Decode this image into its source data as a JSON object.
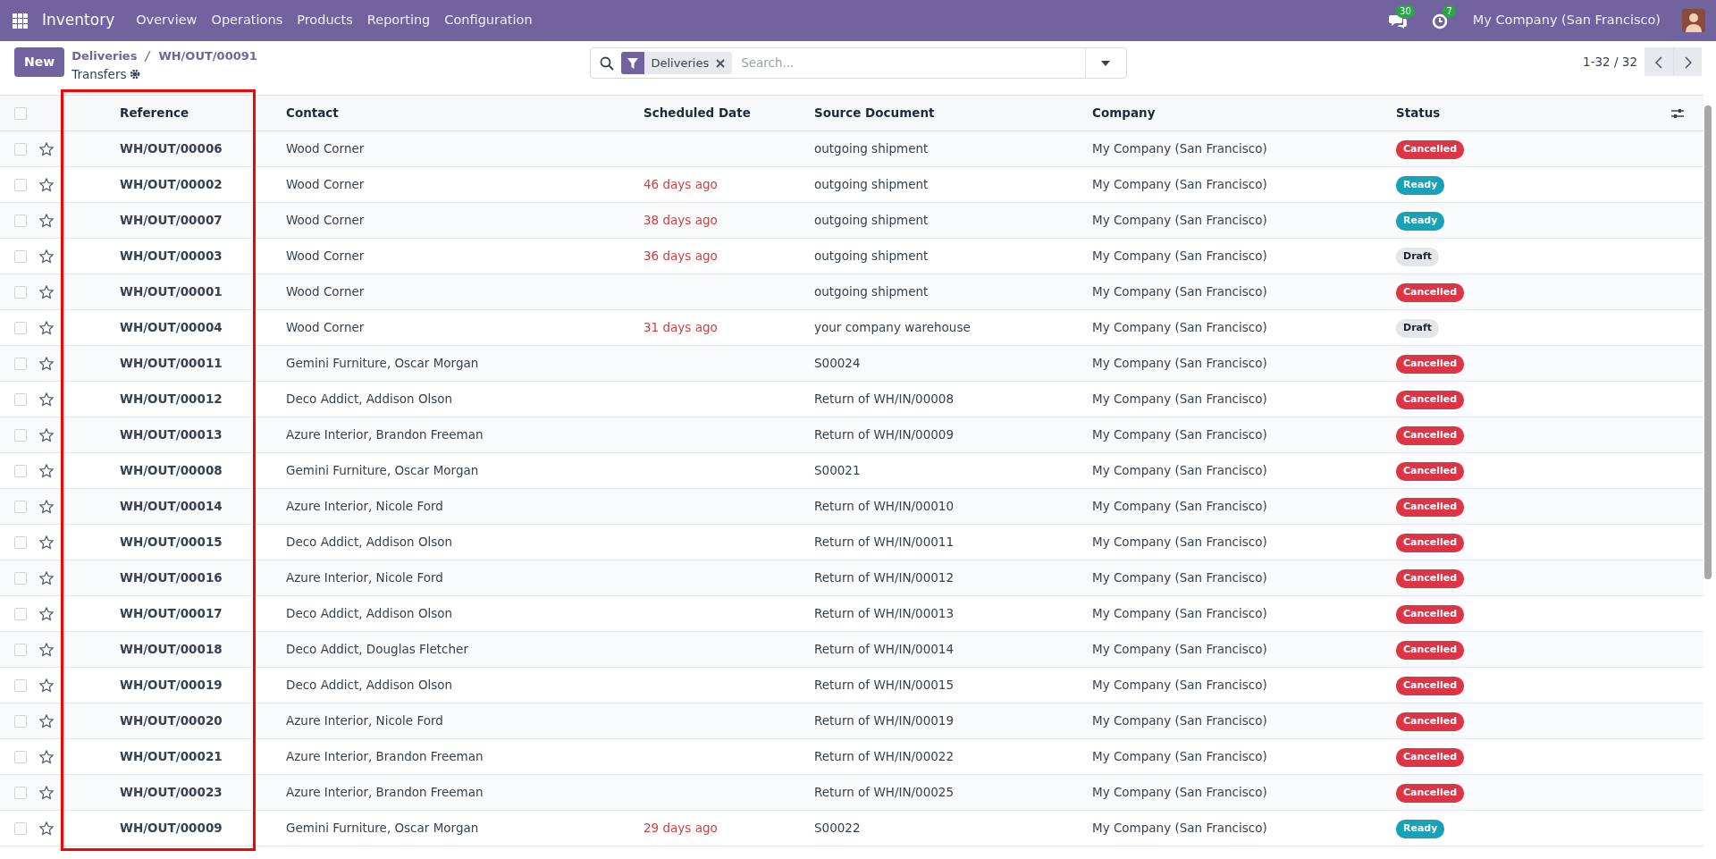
{
  "navbar": {
    "app": "Inventory",
    "menu": [
      "Overview",
      "Operations",
      "Products",
      "Reporting",
      "Configuration"
    ],
    "messages_count": "30",
    "activities_count": "7",
    "company": "My Company (San Francisco)"
  },
  "control_panel": {
    "new_button": "New",
    "breadcrumbs": [
      "Deliveries",
      "WH/OUT/00091"
    ],
    "subtitle": "Transfers",
    "search": {
      "facet": "Deliveries",
      "placeholder": "Search..."
    },
    "pager": "1-32 / 32"
  },
  "table": {
    "all_selected": false,
    "columns": [
      {
        "label": "Reference",
        "highlighted": true
      },
      {
        "label": "Contact",
        "highlighted": false
      },
      {
        "label": "Scheduled Date",
        "highlighted": false
      },
      {
        "label": "Source Document",
        "highlighted": false
      },
      {
        "label": "Company",
        "highlighted": false
      },
      {
        "label": "Status",
        "highlighted": false
      }
    ],
    "rows": [
      {
        "selected": false,
        "starred": false,
        "reference": "WH/OUT/00006",
        "contact": "Wood Corner",
        "source": "outgoing shipment",
        "company": "My Company (San Francisco)",
        "status": {
          "label": "Cancelled",
          "kind": "cancelled"
        }
      },
      {
        "selected": false,
        "starred": false,
        "reference": "WH/OUT/00002",
        "contact": "Wood Corner",
        "scheduled": {
          "text": "46 days ago",
          "overdue": true
        },
        "source": "outgoing shipment",
        "company": "My Company (San Francisco)",
        "status": {
          "label": "Ready",
          "kind": "ready"
        }
      },
      {
        "selected": false,
        "starred": false,
        "reference": "WH/OUT/00007",
        "contact": "Wood Corner",
        "scheduled": {
          "text": "38 days ago",
          "overdue": true
        },
        "source": "outgoing shipment",
        "company": "My Company (San Francisco)",
        "status": {
          "label": "Ready",
          "kind": "ready"
        }
      },
      {
        "selected": false,
        "starred": false,
        "reference": "WH/OUT/00003",
        "contact": "Wood Corner",
        "scheduled": {
          "text": "36 days ago",
          "overdue": true
        },
        "source": "outgoing shipment",
        "company": "My Company (San Francisco)",
        "status": {
          "label": "Draft",
          "kind": "draft"
        }
      },
      {
        "selected": false,
        "starred": false,
        "reference": "WH/OUT/00001",
        "contact": "Wood Corner",
        "source": "outgoing shipment",
        "company": "My Company (San Francisco)",
        "status": {
          "label": "Cancelled",
          "kind": "cancelled"
        }
      },
      {
        "selected": false,
        "starred": false,
        "reference": "WH/OUT/00004",
        "contact": "Wood Corner",
        "scheduled": {
          "text": "31 days ago",
          "overdue": true
        },
        "source": "your company warehouse",
        "company": "My Company (San Francisco)",
        "status": {
          "label": "Draft",
          "kind": "draft"
        }
      },
      {
        "selected": false,
        "starred": false,
        "reference": "WH/OUT/00011",
        "contact": "Gemini Furniture, Oscar Morgan",
        "source": "S00024",
        "company": "My Company (San Francisco)",
        "status": {
          "label": "Cancelled",
          "kind": "cancelled"
        }
      },
      {
        "selected": false,
        "starred": false,
        "reference": "WH/OUT/00012",
        "contact": "Deco Addict, Addison Olson",
        "source": "Return of WH/IN/00008",
        "company": "My Company (San Francisco)",
        "status": {
          "label": "Cancelled",
          "kind": "cancelled"
        }
      },
      {
        "selected": false,
        "starred": false,
        "reference": "WH/OUT/00013",
        "contact": "Azure Interior, Brandon Freeman",
        "source": "Return of WH/IN/00009",
        "company": "My Company (San Francisco)",
        "status": {
          "label": "Cancelled",
          "kind": "cancelled"
        }
      },
      {
        "selected": false,
        "starred": false,
        "reference": "WH/OUT/00008",
        "contact": "Gemini Furniture, Oscar Morgan",
        "source": "S00021",
        "company": "My Company (San Francisco)",
        "status": {
          "label": "Cancelled",
          "kind": "cancelled"
        }
      },
      {
        "selected": false,
        "starred": false,
        "reference": "WH/OUT/00014",
        "contact": "Azure Interior, Nicole Ford",
        "source": "Return of WH/IN/00010",
        "company": "My Company (San Francisco)",
        "status": {
          "label": "Cancelled",
          "kind": "cancelled"
        }
      },
      {
        "selected": false,
        "starred": false,
        "reference": "WH/OUT/00015",
        "contact": "Deco Addict, Addison Olson",
        "source": "Return of WH/IN/00011",
        "company": "My Company (San Francisco)",
        "status": {
          "label": "Cancelled",
          "kind": "cancelled"
        }
      },
      {
        "selected": false,
        "starred": false,
        "reference": "WH/OUT/00016",
        "contact": "Azure Interior, Nicole Ford",
        "source": "Return of WH/IN/00012",
        "company": "My Company (San Francisco)",
        "status": {
          "label": "Cancelled",
          "kind": "cancelled"
        }
      },
      {
        "selected": false,
        "starred": false,
        "reference": "WH/OUT/00017",
        "contact": "Deco Addict, Addison Olson",
        "source": "Return of WH/IN/00013",
        "company": "My Company (San Francisco)",
        "status": {
          "label": "Cancelled",
          "kind": "cancelled"
        }
      },
      {
        "selected": false,
        "starred": false,
        "reference": "WH/OUT/00018",
        "contact": "Deco Addict, Douglas Fletcher",
        "source": "Return of WH/IN/00014",
        "company": "My Company (San Francisco)",
        "status": {
          "label": "Cancelled",
          "kind": "cancelled"
        }
      },
      {
        "selected": false,
        "starred": false,
        "reference": "WH/OUT/00019",
        "contact": "Deco Addict, Addison Olson",
        "source": "Return of WH/IN/00015",
        "company": "My Company (San Francisco)",
        "status": {
          "label": "Cancelled",
          "kind": "cancelled"
        }
      },
      {
        "selected": false,
        "starred": false,
        "reference": "WH/OUT/00020",
        "contact": "Azure Interior, Nicole Ford",
        "source": "Return of WH/IN/00019",
        "company": "My Company (San Francisco)",
        "status": {
          "label": "Cancelled",
          "kind": "cancelled"
        }
      },
      {
        "selected": false,
        "starred": false,
        "reference": "WH/OUT/00021",
        "contact": "Azure Interior, Brandon Freeman",
        "source": "Return of WH/IN/00022",
        "company": "My Company (San Francisco)",
        "status": {
          "label": "Cancelled",
          "kind": "cancelled"
        }
      },
      {
        "selected": false,
        "starred": false,
        "reference": "WH/OUT/00023",
        "contact": "Azure Interior, Brandon Freeman",
        "source": "Return of WH/IN/00025",
        "company": "My Company (San Francisco)",
        "status": {
          "label": "Cancelled",
          "kind": "cancelled"
        }
      },
      {
        "selected": false,
        "starred": false,
        "reference": "WH/OUT/00009",
        "contact": "Gemini Furniture, Oscar Morgan",
        "scheduled": {
          "text": "29 days ago",
          "overdue": true
        },
        "source": "S00022",
        "company": "My Company (San Francisco)",
        "status": {
          "label": "Ready",
          "kind": "ready"
        }
      }
    ]
  }
}
